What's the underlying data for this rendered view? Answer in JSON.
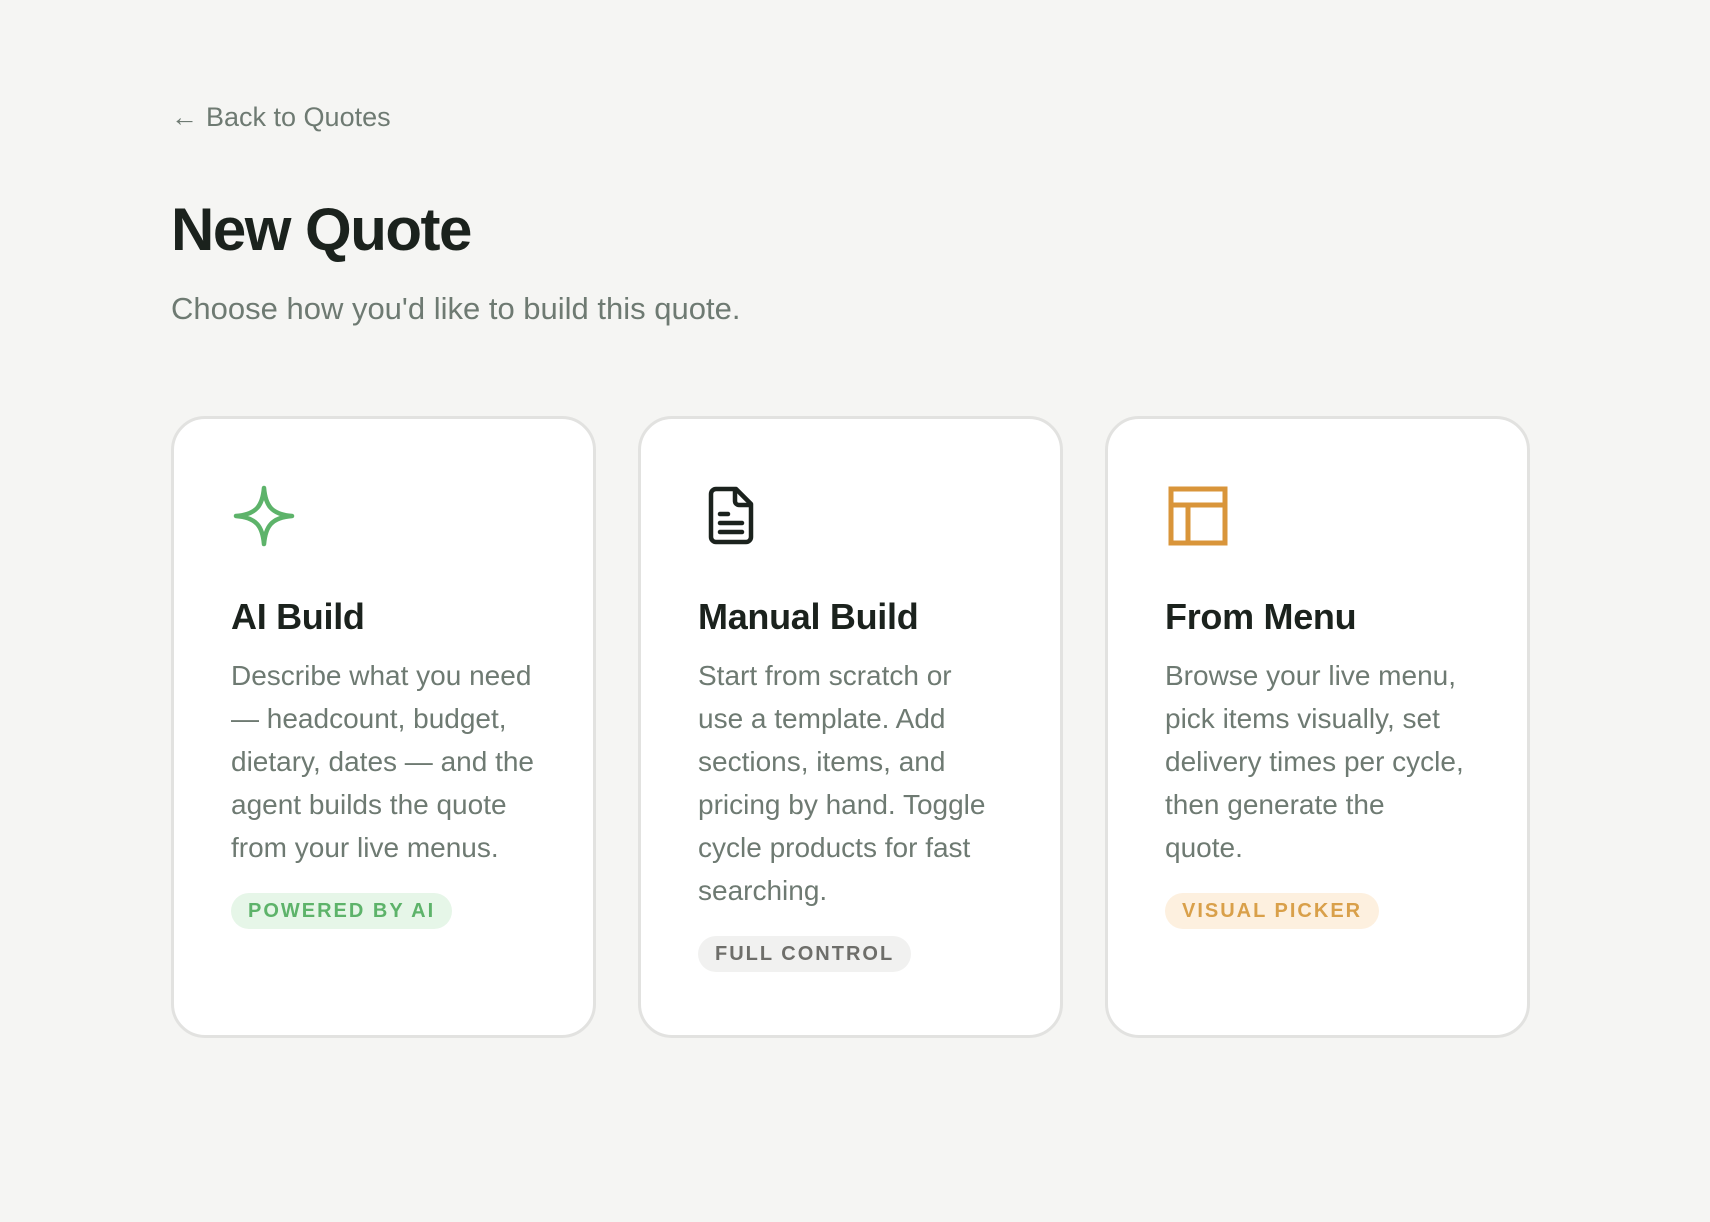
{
  "nav": {
    "back_arrow": "←",
    "back_label": "Back to Quotes"
  },
  "header": {
    "title": "New Quote",
    "subtitle": "Choose how you'd like to build this quote."
  },
  "cards": [
    {
      "icon": "sparkle-icon",
      "title": "AI Build",
      "description": "Describe what you need — headcount, budget, dietary, dates — and the agent builds the quote from your live menus.",
      "badge": "POWERED BY AI",
      "accent_color": "#5db36a"
    },
    {
      "icon": "document-icon",
      "title": "Manual Build",
      "description": "Start from scratch or use a template. Add sections, items, and pricing by hand. Toggle cycle products for fast searching.",
      "badge": "FULL CONTROL",
      "accent_color": "#1b221d"
    },
    {
      "icon": "layout-icon",
      "title": "From Menu",
      "description": "Browse your live menu, pick items visually, set delivery times per cycle, then generate the quote.",
      "badge": "VISUAL PICKER",
      "accent_color": "#d9953a"
    }
  ],
  "colors": {
    "background": "#f5f5f3",
    "text_primary": "#1b221d",
    "text_muted": "#6e7a72",
    "green": "#5db36a",
    "orange": "#d9953a"
  }
}
